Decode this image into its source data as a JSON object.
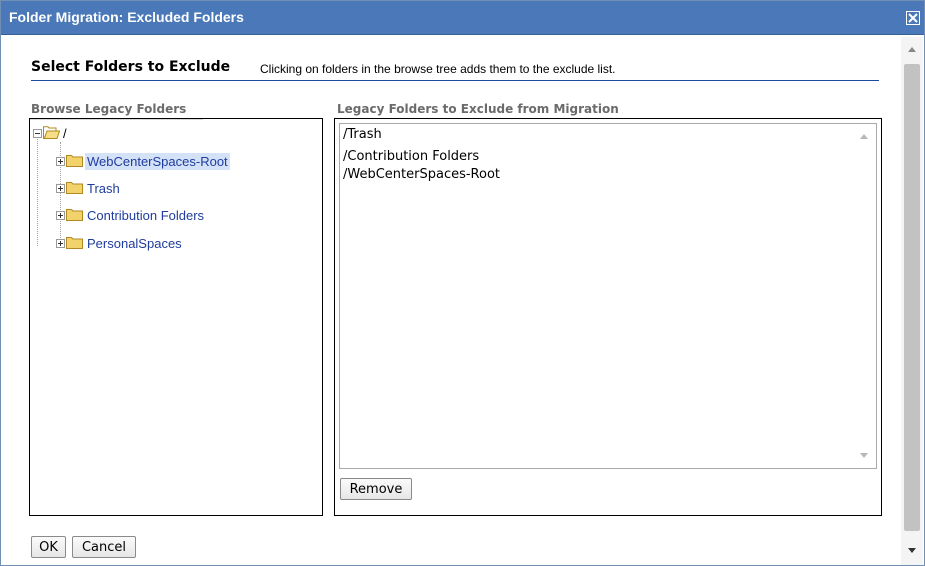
{
  "dialog": {
    "title": "Folder Migration: Excluded Folders",
    "close_icon": "close-icon"
  },
  "header": {
    "title": "Select Folders to Exclude",
    "description": "Clicking on folders in the browse tree adds them to the exclude list."
  },
  "browse": {
    "label": "Browse Legacy Folders",
    "root": "/",
    "items": [
      {
        "label": "WebCenterSpaces-Root",
        "selected": true
      },
      {
        "label": "Trash",
        "selected": false
      },
      {
        "label": "Contribution Folders",
        "selected": false
      },
      {
        "label": "PersonalSpaces",
        "selected": false
      }
    ]
  },
  "exclude": {
    "label": "Legacy Folders to Exclude from Migration",
    "items": [
      "/Trash",
      "/Contribution Folders",
      "/WebCenterSpaces-Root"
    ],
    "remove_label": "Remove"
  },
  "footer": {
    "ok_label": "OK",
    "cancel_label": "Cancel"
  },
  "colors": {
    "titlebar": "#4a78b8",
    "link": "#1f3c9e",
    "selected_bg": "#d4e2f7",
    "folder": "#f2d36b"
  }
}
